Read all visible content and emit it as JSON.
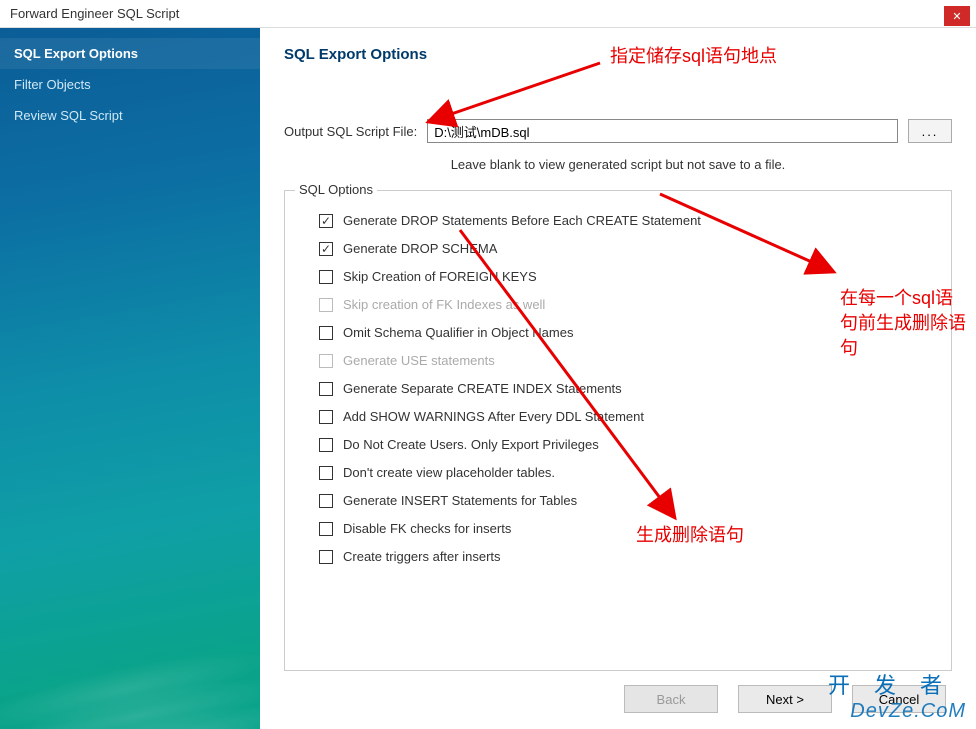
{
  "window": {
    "title": "Forward Engineer SQL Script"
  },
  "sidebar": {
    "items": [
      {
        "label": "SQL Export Options",
        "active": true
      },
      {
        "label": "Filter Objects",
        "active": false
      },
      {
        "label": "Review SQL Script",
        "active": false
      }
    ]
  },
  "page": {
    "heading": "SQL Export Options",
    "output_label": "Output SQL Script File:",
    "output_value": "D:\\测试\\mDB.sql",
    "browse_label": "...",
    "hint": "Leave blank to view generated script but not save to a file.",
    "fieldset_title": "SQL Options",
    "options": [
      {
        "label": "Generate DROP Statements Before Each CREATE Statement",
        "checked": true,
        "disabled": false
      },
      {
        "label": "Generate DROP SCHEMA",
        "checked": true,
        "disabled": false
      },
      {
        "label": "Skip Creation of FOREIGN KEYS",
        "checked": false,
        "disabled": false
      },
      {
        "label": "Skip creation of FK Indexes as well",
        "checked": false,
        "disabled": true
      },
      {
        "label": "Omit Schema Qualifier in Object Names",
        "checked": false,
        "disabled": false
      },
      {
        "label": "Generate USE statements",
        "checked": false,
        "disabled": true
      },
      {
        "label": "Generate Separate CREATE INDEX Statements",
        "checked": false,
        "disabled": false
      },
      {
        "label": "Add SHOW WARNINGS After Every DDL Statement",
        "checked": false,
        "disabled": false
      },
      {
        "label": "Do Not Create Users. Only Export Privileges",
        "checked": false,
        "disabled": false
      },
      {
        "label": "Don't create view placeholder tables.",
        "checked": false,
        "disabled": false
      },
      {
        "label": "Generate INSERT Statements for Tables",
        "checked": false,
        "disabled": false
      },
      {
        "label": "Disable FK checks for inserts",
        "checked": false,
        "disabled": false
      },
      {
        "label": "Create triggers after inserts",
        "checked": false,
        "disabled": false
      }
    ]
  },
  "footer": {
    "back": "Back",
    "next": "Next >",
    "cancel": "Cancel"
  },
  "annotations": {
    "a1": "指定储存sql语句地点",
    "a2": "在每一个sql语句前生成删除语句",
    "a3": "生成删除语句"
  },
  "watermark": {
    "line1": "开发者",
    "line2": "DevZe.CoM"
  }
}
